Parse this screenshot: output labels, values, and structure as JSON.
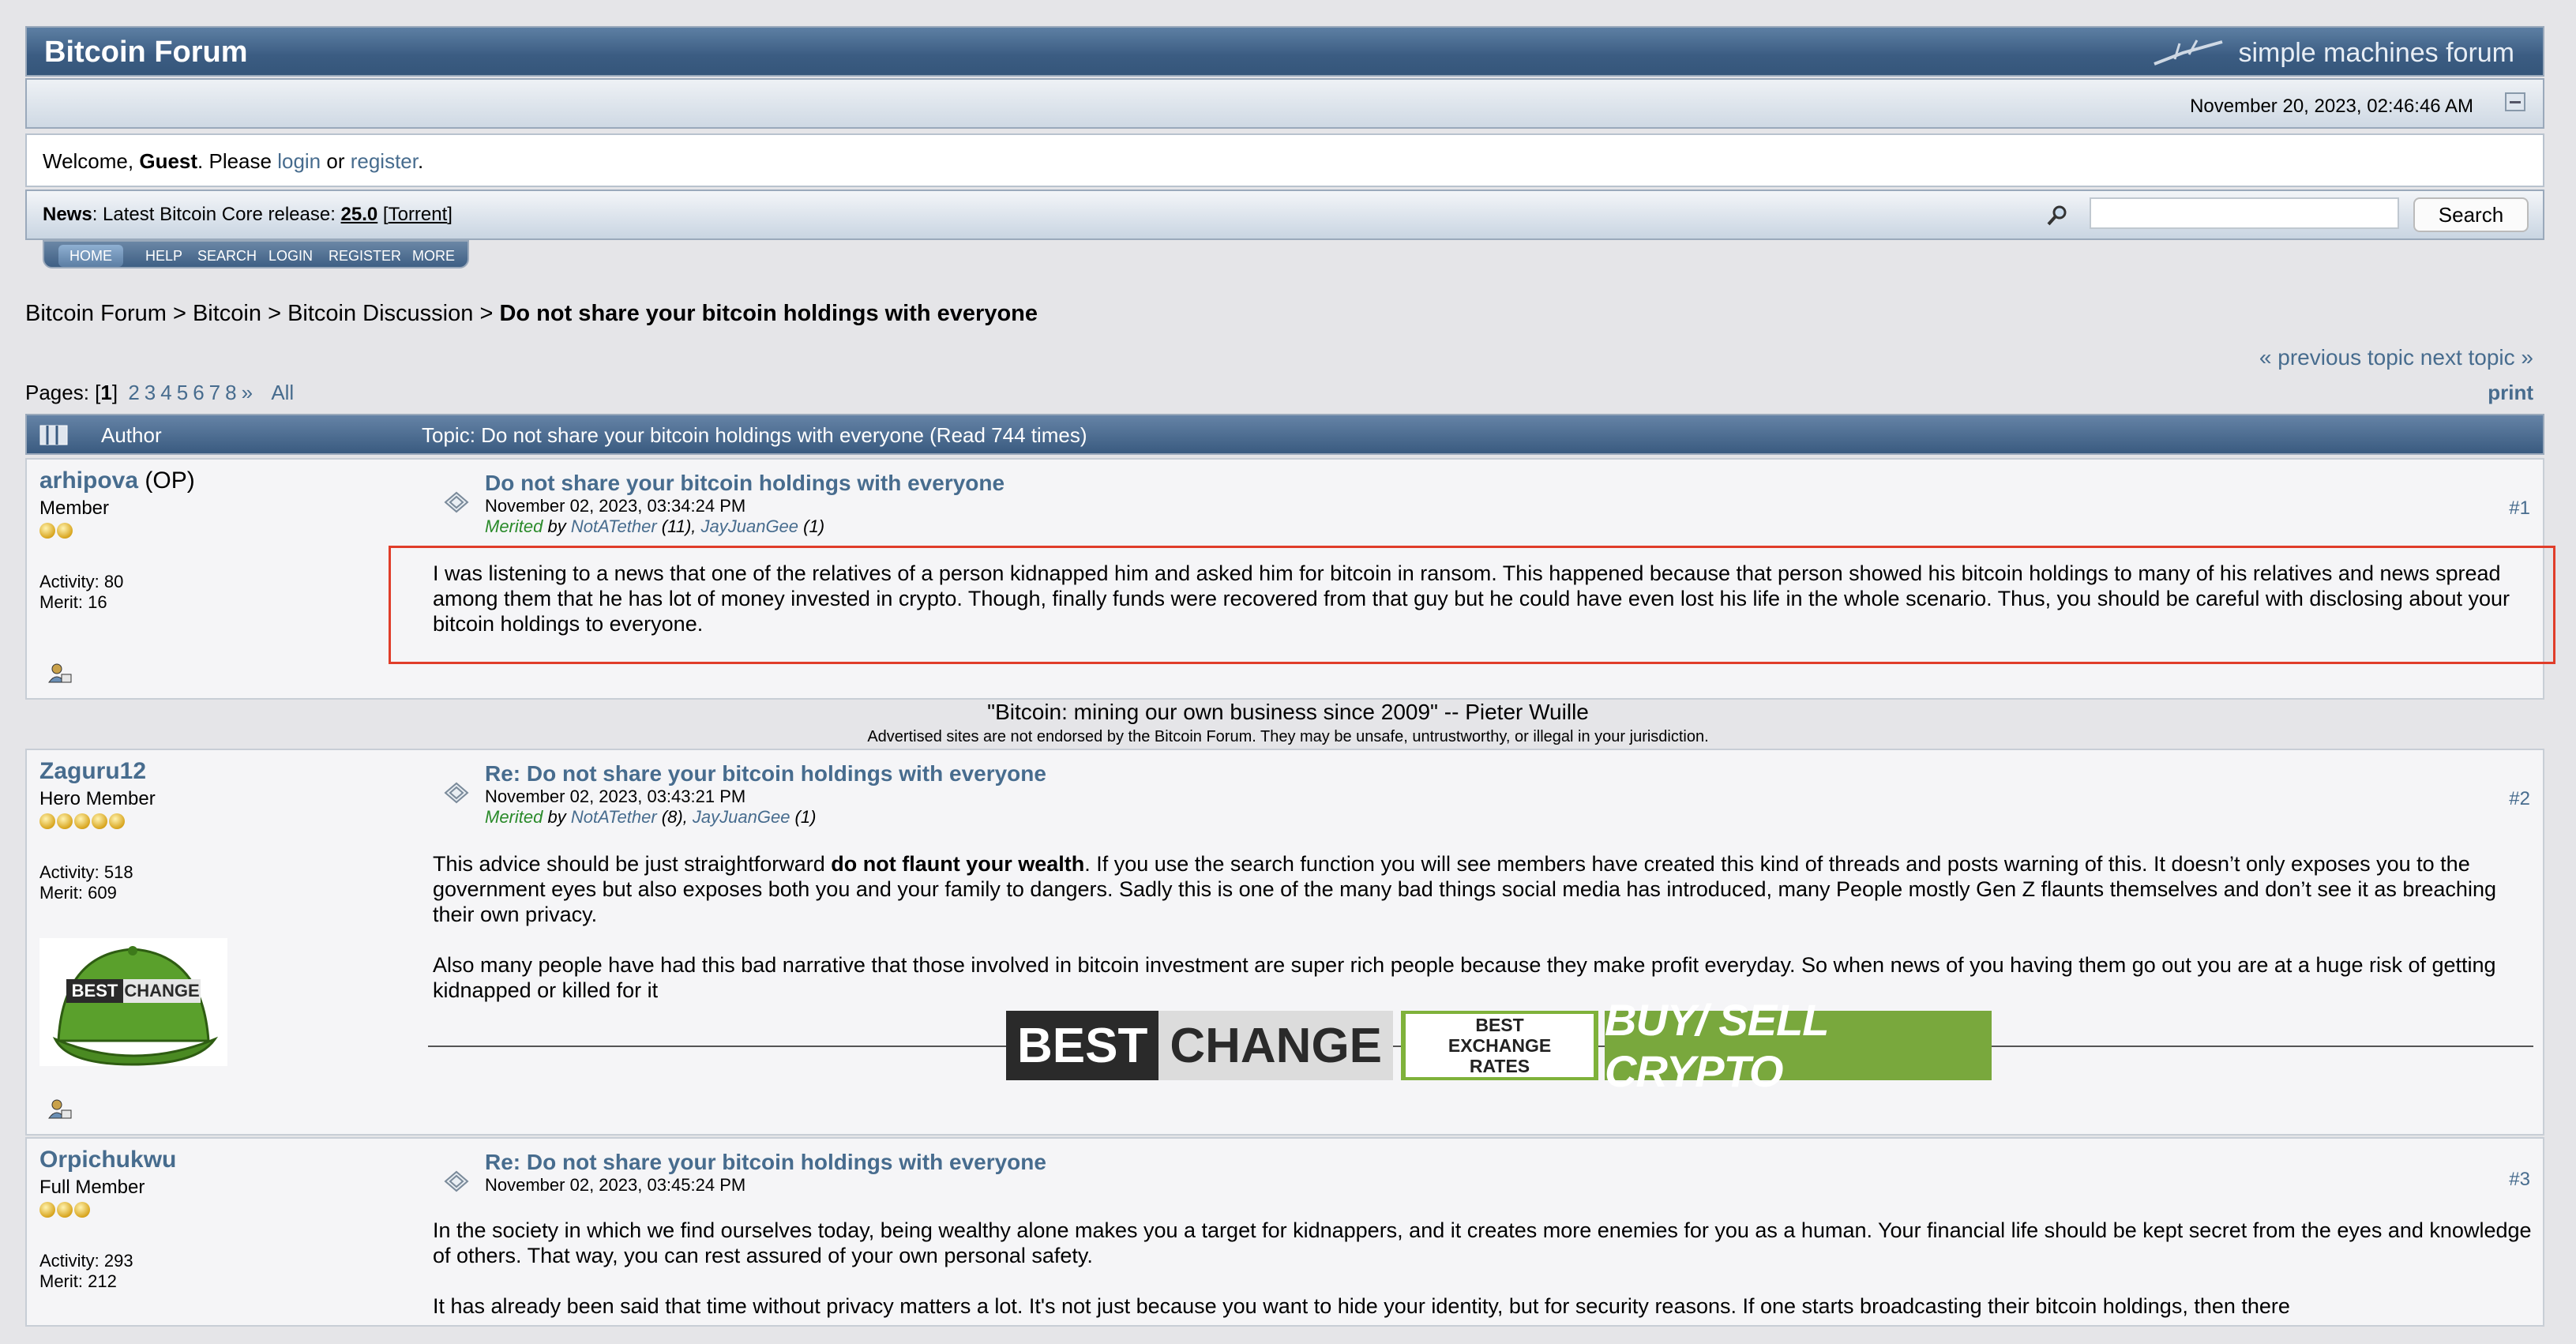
{
  "header": {
    "forum_title": "Bitcoin Forum",
    "smf_logo_text": "simple machines forum",
    "date": "November 20, 2023, 02:46:46 AM"
  },
  "welcome": {
    "prefix": "Welcome, ",
    "guest": "Guest",
    "mid": ". Please ",
    "login": "login",
    "or": " or ",
    "register": "register",
    "suffix": "."
  },
  "news": {
    "label": "News",
    "text": ": Latest Bitcoin Core release: ",
    "version": "25.0",
    "torrent": "Torrent",
    "lb": " [",
    "rb": "]"
  },
  "search": {
    "placeholder": "",
    "button": "Search"
  },
  "menu": [
    "HOME",
    "HELP",
    "SEARCH",
    "LOGIN",
    "REGISTER",
    "MORE"
  ],
  "breadcrumb": {
    "items": [
      "Bitcoin Forum",
      "Bitcoin",
      "Bitcoin Discussion"
    ],
    "separator": ">",
    "current": "Do not share your bitcoin holdings with everyone"
  },
  "topic_nav": {
    "previous": "« previous topic",
    "next": "next topic »"
  },
  "pages": {
    "label": "Pages: ",
    "current": "1",
    "others": [
      "2",
      "3",
      "4",
      "5",
      "6",
      "7",
      "8",
      "»"
    ],
    "all": "All"
  },
  "print": "print",
  "topic_header": {
    "author": "Author",
    "topic": "Topic: Do not share your bitcoin holdings with everyone  (Read 744 times)"
  },
  "posts": [
    {
      "author": "arhipova",
      "op": "(OP)",
      "rank": "Member",
      "stars": 2,
      "activity": "Activity: 80",
      "merit": "Merit: 16",
      "subject": "Do not share your bitcoin holdings with everyone",
      "date": "November 02, 2023, 03:34:24 PM",
      "merited_label": "Merited",
      "merited_by": " by ",
      "merit_users": [
        "NotATether",
        "JayJuanGee"
      ],
      "merit_counts": [
        " (11), ",
        " (1)"
      ],
      "number": "#1",
      "body": [
        "I was listening to a news that one of the relatives of a person kidnapped him and asked him for bitcoin in ransom. This happened because that person showed his bitcoin holdings to many of his relatives and news spread among them that he has lot of money invested in crypto. Though, finally funds were recovered from that guy but he could have even lost his life in the whole scenario. Thus, you should be careful with disclosing about your bitcoin holdings to everyone."
      ]
    },
    {
      "author": "Zaguru12",
      "rank": "Hero Member",
      "stars": 5,
      "activity": "Activity: 518",
      "merit": "Merit: 609",
      "subject": "Re: Do not share your bitcoin holdings with everyone",
      "date": "November 02, 2023, 03:43:21 PM",
      "merited_label": "Merited",
      "merited_by": " by ",
      "merit_users": [
        "NotATether",
        "JayJuanGee"
      ],
      "merit_counts": [
        " (8), ",
        " (1)"
      ],
      "number": "#2",
      "body_p1_a": "This advice should be just straightforward ",
      "body_p1_b": "do not flaunt your wealth",
      "body_p1_c": ". If you use the search function you will see members have created this kind of threads and posts warning of this. It doesn’t only exposes you to the government eyes but also exposes both you and your family to dangers. Sadly this is one of the many bad things social media has introduced, many People mostly Gen Z flaunts themselves and don’t see it as breaching their own privacy.",
      "body_p2": "Also many people have had this bad narrative that those involved in bitcoin investment are super rich people because they make profit everyday. So when news of you having them go out you are at a huge risk of getting kidnapped or killed for it",
      "avatar_text": [
        "BEST",
        "CHANGE"
      ],
      "banner": {
        "best": "BEST",
        "change": "CHANGE",
        "rates": [
          "BEST",
          "EXCHANGE",
          "RATES"
        ],
        "buy": "BUY/ SELL CRYPTO"
      }
    },
    {
      "author": "Orpichukwu",
      "rank": "Full Member",
      "stars": 3,
      "activity": "Activity: 293",
      "merit": "Merit: 212",
      "subject": "Re: Do not share your bitcoin holdings with everyone",
      "date": "November 02, 2023, 03:45:24 PM",
      "number": "#3",
      "body_p1": "In the society in which we find ourselves today, being wealthy alone makes you a target for kidnappers, and it creates more enemies for you as a human. Your financial life should be kept secret from the eyes and knowledge of others. That way, you can rest assured of your own personal safety.",
      "body_p2": "It has already been said that time without privacy matters a lot. It's not just because you want to hide your identity, but for security reasons. If one starts broadcasting their bitcoin holdings, then there"
    }
  ],
  "signature": {
    "quote": "\"Bitcoin: mining our own business since 2009\" -- Pieter Wuille",
    "advert": "Advertised sites are not endorsed by the Bitcoin Forum. They may be unsafe, untrustworthy, or illegal in your jurisdiction."
  },
  "colors": {
    "link": "#476c8e",
    "highlight": "#e03d2a",
    "merited": "#2a8a2a"
  }
}
